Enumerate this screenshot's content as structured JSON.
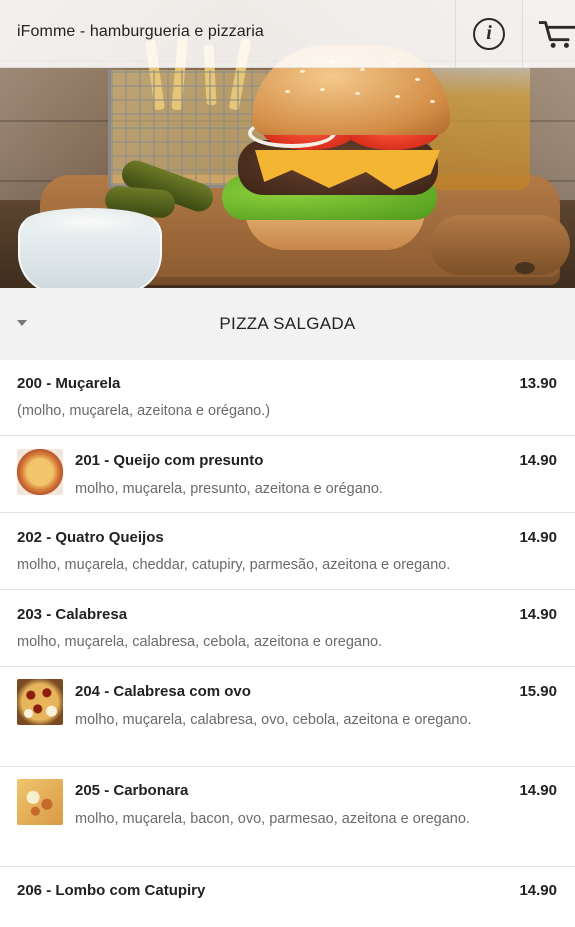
{
  "header": {
    "title": "iFomme - hamburgueria e pizzaria",
    "info_icon": "info-icon",
    "cart_icon": "cart-icon"
  },
  "hero": {
    "image": "burger-banner-image"
  },
  "category": {
    "name": "PIZZA SALGADA",
    "toggle_icon": "caret-down-icon"
  },
  "items": [
    {
      "title": "200 - Muçarela",
      "price": "13.90",
      "desc": "(molho, muçarela, azeitona e orégano.)"
    },
    {
      "title": "201 - Queijo com presunto",
      "price": "14.90",
      "desc": "molho, muçarela, presunto, azeitona e orégano."
    },
    {
      "title": "202 - Quatro Queijos",
      "price": "14.90",
      "desc": "molho, muçarela, cheddar, catupiry, parmesão, azeitona e oregano."
    },
    {
      "title": "203 - Calabresa",
      "price": "14.90",
      "desc": "molho, muçarela, calabresa, cebola, azeitona e oregano."
    },
    {
      "title": "204 - Calabresa com ovo",
      "price": "15.90",
      "desc": "molho, muçarela, calabresa, ovo, cebola, azeitona e oregano."
    },
    {
      "title": "205 - Carbonara",
      "price": "14.90",
      "desc": "molho, muçarela, bacon, ovo, parmesao, azeitona e oregano."
    },
    {
      "title": "206 - Lombo com Catupiry",
      "price": "14.90",
      "desc": ""
    }
  ]
}
